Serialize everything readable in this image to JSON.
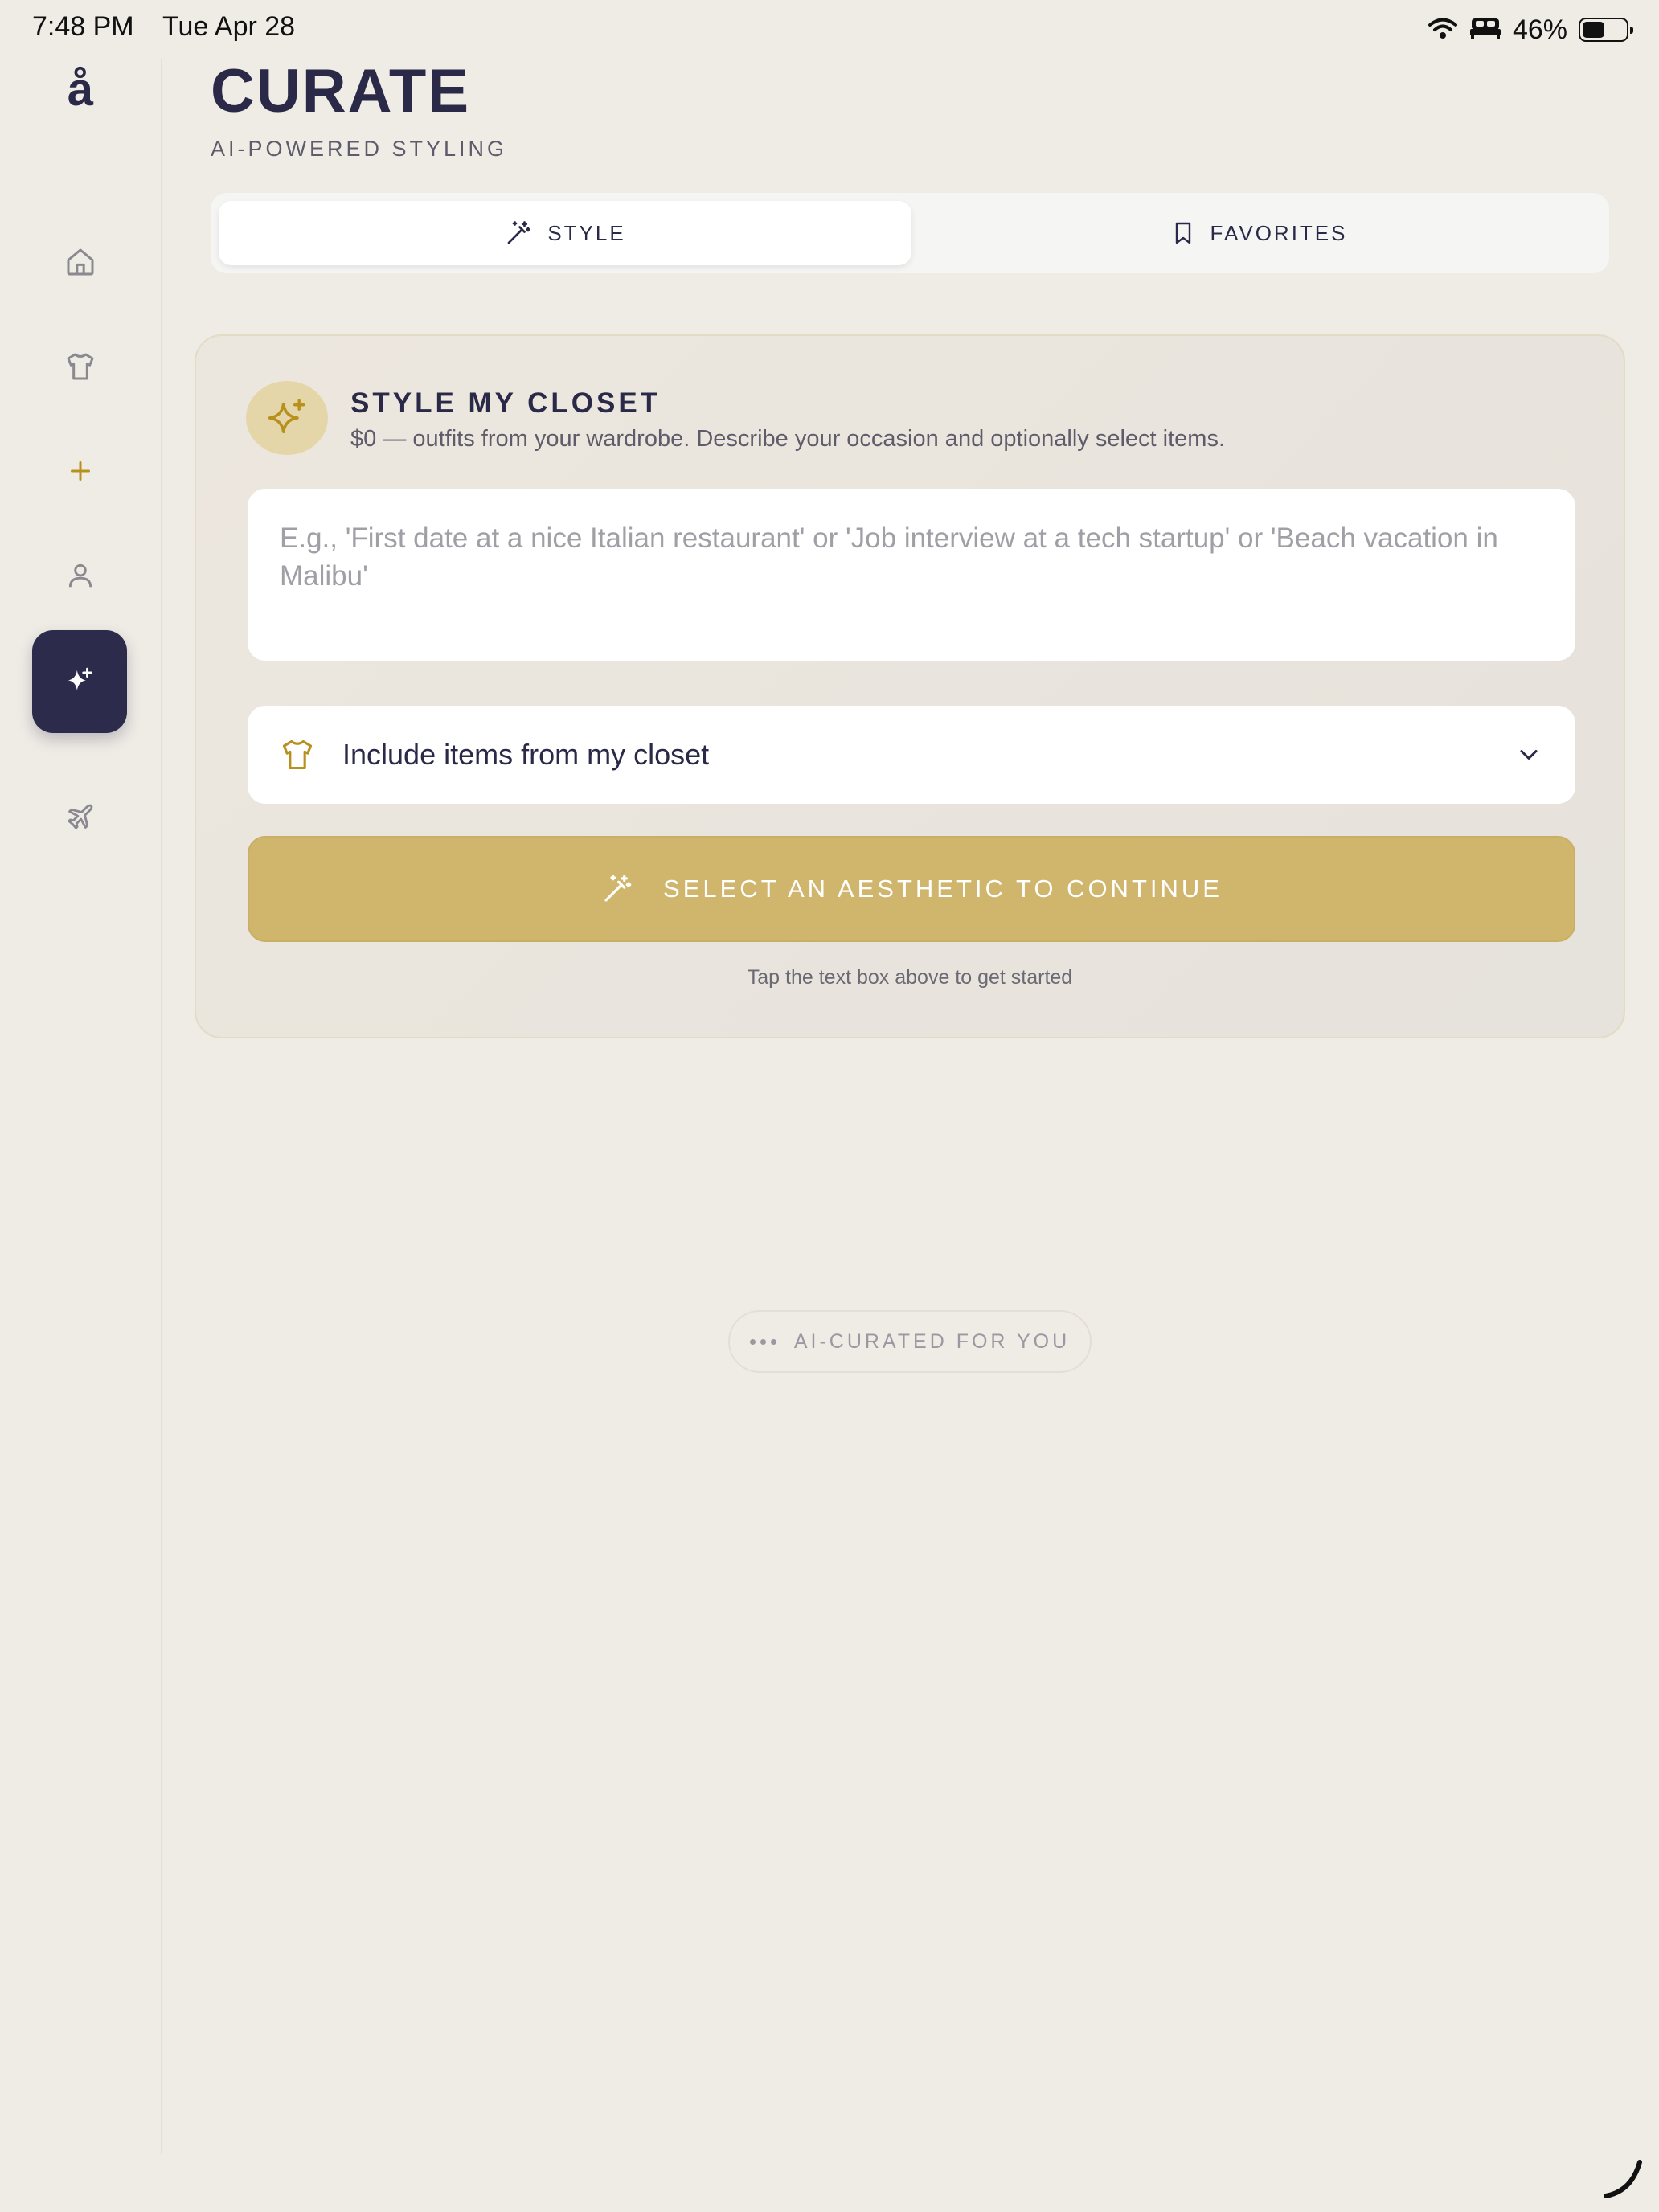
{
  "status_bar": {
    "time": "7:48 PM",
    "date": "Tue Apr 28",
    "battery_percent": "46%",
    "battery_level": 0.46
  },
  "sidebar": {
    "logo": "å",
    "items": [
      {
        "icon": "home-icon"
      },
      {
        "icon": "shirt-icon"
      },
      {
        "icon": "plus-icon"
      },
      {
        "icon": "user-icon"
      },
      {
        "icon": "sparkle-icon",
        "active": true
      },
      {
        "icon": "airplane-icon"
      }
    ]
  },
  "header": {
    "title": "CURATE",
    "subtitle": "AI-POWERED STYLING"
  },
  "tabs": [
    {
      "label": "STYLE",
      "icon": "magic-wand-icon",
      "active": true
    },
    {
      "label": "FAVORITES",
      "icon": "bookmark-icon",
      "active": false
    }
  ],
  "card": {
    "title": "STYLE MY CLOSET",
    "subtitle": "$0 — outfits from your wardrobe. Describe your occasion and optionally select items.",
    "input_placeholder": "E.g., 'First date at a nice Italian restaurant' or 'Job interview at a tech startup' or 'Beach vacation in Malibu'",
    "input_value": "",
    "closet_select_label": "Include items from my closet",
    "continue_button": "SELECT AN AESTHETIC TO CONTINUE",
    "hint": "Tap the text box above to get started"
  },
  "footer_pill": {
    "label": "AI-CURATED FOR YOU"
  },
  "colors": {
    "background": "#efebe5",
    "navy": "#2d2b4b",
    "gold": "#d0b56d",
    "gold_icon": "#b8901e"
  }
}
